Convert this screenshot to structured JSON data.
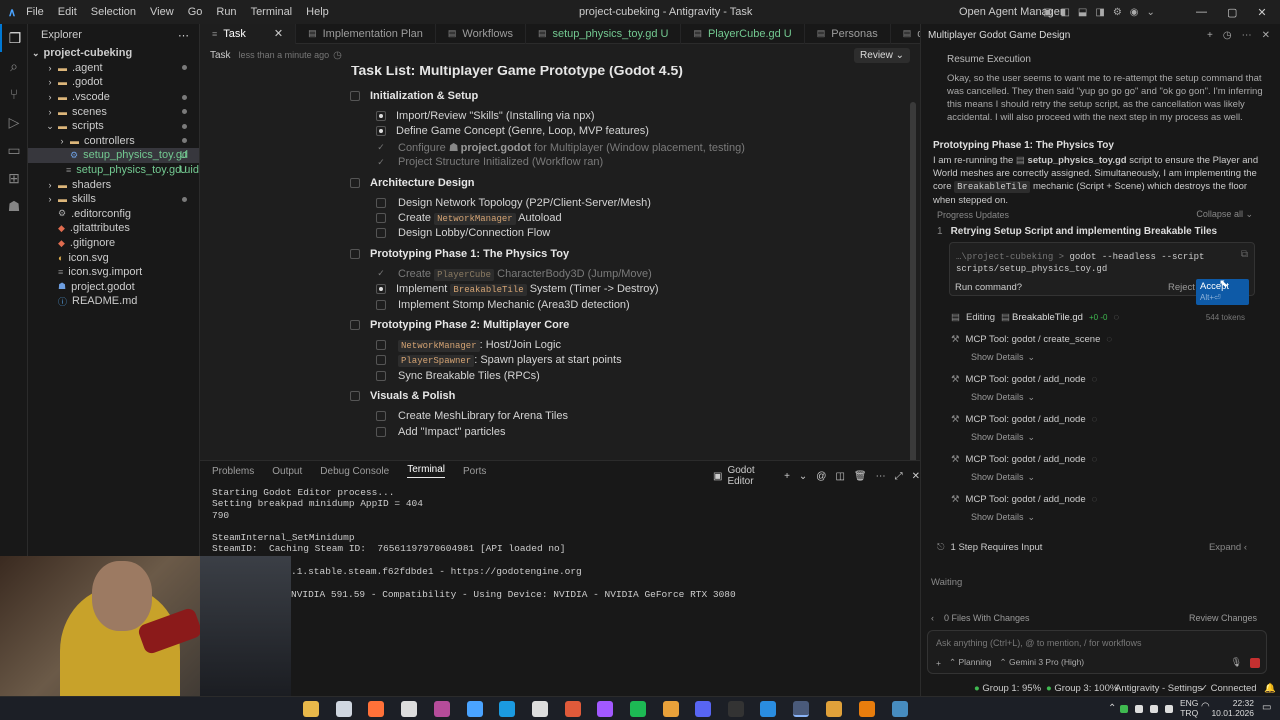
{
  "menu": [
    "File",
    "Edit",
    "Selection",
    "View",
    "Go",
    "Run",
    "Terminal",
    "Help"
  ],
  "window_title": "project-cubeking - Antigravity - Task",
  "open_agent_manager": "Open Agent Manager",
  "explorer": {
    "title": "Explorer",
    "root": "project-cubeking",
    "items": [
      {
        "label": ".agent",
        "indent": 1,
        "type": "folder",
        "dot": true
      },
      {
        "label": ".godot",
        "indent": 1,
        "type": "folder"
      },
      {
        "label": ".vscode",
        "indent": 1,
        "type": "folder",
        "dot": true
      },
      {
        "label": "scenes",
        "indent": 1,
        "type": "folder",
        "dot": true
      },
      {
        "label": "scripts",
        "indent": 1,
        "type": "folder-open",
        "dot": true
      },
      {
        "label": "controllers",
        "indent": 2,
        "type": "folder",
        "dot": true
      },
      {
        "label": "setup_physics_toy.gd",
        "indent": 2,
        "type": "gd",
        "badge": "U",
        "selected": true
      },
      {
        "label": "setup_physics_toy.gd.uid",
        "indent": 2,
        "type": "file",
        "badge": "U"
      },
      {
        "label": "shaders",
        "indent": 1,
        "type": "folder"
      },
      {
        "label": "skills",
        "indent": 1,
        "type": "folder",
        "dot": true
      },
      {
        "label": ".editorconfig",
        "indent": 1,
        "type": "cfg"
      },
      {
        "label": ".gitattributes",
        "indent": 1,
        "type": "git"
      },
      {
        "label": ".gitignore",
        "indent": 1,
        "type": "git"
      },
      {
        "label": "icon.svg",
        "indent": 1,
        "type": "svg"
      },
      {
        "label": "icon.svg.import",
        "indent": 1,
        "type": "file"
      },
      {
        "label": "project.godot",
        "indent": 1,
        "type": "godot"
      },
      {
        "label": "README.md",
        "indent": 1,
        "type": "md"
      }
    ]
  },
  "tabs": [
    {
      "label": "Task",
      "active": true
    },
    {
      "label": "Implementation Plan"
    },
    {
      "label": "Workflows"
    },
    {
      "label": "setup_physics_toy.gd U"
    },
    {
      "label": "PlayerCube.gd U"
    },
    {
      "label": "Personas"
    },
    {
      "label": "debug_"
    }
  ],
  "task_header": {
    "label": "Task",
    "time": "less than a minute ago",
    "review": "Review"
  },
  "task_title": "Task List: Multiplayer Game Prototype (Godot 4.5)",
  "sections": [
    {
      "title": "Initialization & Setup",
      "items": [
        {
          "state": "progress",
          "parts": [
            {
              "t": "Import/Review \"Skills\" (Installing via npx)"
            }
          ]
        },
        {
          "state": "progress",
          "parts": [
            {
              "t": "Define Game Concept (Genre, Loop, MVP features)"
            }
          ]
        },
        {
          "state": "done",
          "parts": [
            {
              "t": "Configure "
            },
            {
              "t": "project.godot",
              "bold": true
            },
            {
              "t": " for Multiplayer (Window placement, testing)"
            }
          ]
        },
        {
          "state": "done",
          "parts": [
            {
              "t": "Project Structure Initialized (Workflow ran)"
            }
          ]
        }
      ]
    },
    {
      "title": "Architecture Design",
      "items": [
        {
          "state": "todo",
          "parts": [
            {
              "t": "Design Network Topology (P2P/Client-Server/Mesh)"
            }
          ]
        },
        {
          "state": "todo",
          "parts": [
            {
              "t": "Create "
            },
            {
              "t": "NetworkManager",
              "code": true
            },
            {
              "t": " Autoload"
            }
          ]
        },
        {
          "state": "todo",
          "parts": [
            {
              "t": "Design Lobby/Connection Flow"
            }
          ]
        }
      ]
    },
    {
      "title": "Prototyping Phase 1: The Physics Toy",
      "items": [
        {
          "state": "done",
          "parts": [
            {
              "t": "Create "
            },
            {
              "t": "PlayerCube",
              "code": true
            },
            {
              "t": " CharacterBody3D (Jump/Move)"
            }
          ]
        },
        {
          "state": "progress",
          "parts": [
            {
              "t": "Implement "
            },
            {
              "t": "BreakableTile",
              "code": true
            },
            {
              "t": " System (Timer -> Destroy)"
            }
          ]
        },
        {
          "state": "todo",
          "parts": [
            {
              "t": "Implement Stomp Mechanic (Area3D detection)"
            }
          ]
        }
      ]
    },
    {
      "title": "Prototyping Phase 2: Multiplayer Core",
      "items": [
        {
          "state": "todo",
          "parts": [
            {
              "t": "NetworkManager",
              "code": true
            },
            {
              "t": ": Host/Join Logic"
            }
          ]
        },
        {
          "state": "todo",
          "parts": [
            {
              "t": "PlayerSpawner",
              "code": true
            },
            {
              "t": ": Spawn players at start points"
            }
          ]
        },
        {
          "state": "todo",
          "parts": [
            {
              "t": "Sync Breakable Tiles (RPCs)"
            }
          ]
        }
      ]
    },
    {
      "title": "Visuals & Polish",
      "items": [
        {
          "state": "todo",
          "parts": [
            {
              "t": "Create MeshLibrary for Arena Tiles"
            }
          ]
        },
        {
          "state": "todo",
          "parts": [
            {
              "t": "Add \"Impact\" particles"
            }
          ]
        }
      ]
    }
  ],
  "terminal": {
    "tabs": [
      "Problems",
      "Output",
      "Debug Console",
      "Terminal",
      "Ports"
    ],
    "active": "Terminal",
    "profile": "Godot Editor",
    "lines": [
      "Starting Godot Editor process...",
      "Setting breakpad minidump AppID = 404",
      "790",
      "",
      "SteamInternal_SetMinidump",
      "SteamID:  Caching Steam ID:  76561197970604981 [API loaded no]",
      "",
      ".1.stable.steam.f62fdbde1 - https://godotengine.org",
      "",
      "NVIDIA 591.59 - Compatibility - Using Device: NVIDIA - NVIDIA GeForce RTX 3080"
    ]
  },
  "agent": {
    "title": "Multiplayer Godot Game Design",
    "resume": "Resume Execution",
    "thought": "Okay, so the user seems to want me to re-attempt the setup command that was cancelled. They then said \"yup go go go\" and \"ok go gon\". I'm inferring this means I should retry the setup script, as the cancellation was likely accidental. I will also proceed with the next step in my process as well.",
    "phase_title": "Prototyping Phase 1: The Physics Toy",
    "phase_pre": "I am re-running the ",
    "phase_file": "setup_physics_toy.gd",
    "phase_mid": " script to ensure the Player and World meshes are correctly assigned. Simultaneously, I am implementing the core ",
    "phase_code": "BreakableTile",
    "phase_post": " mechanic (Script + Scene) which destroys the floor when stepped on.",
    "progress_label": "Progress Updates",
    "collapse": "Collapse all",
    "step_title": "Retrying Setup Script and implementing Breakable Tiles",
    "cmd_path": "…\\project-cubeking",
    "cmd": "godot --headless --script scripts/setup_physics_toy.gd",
    "run_q": "Run command?",
    "reject": "Reject",
    "accept": "Accept",
    "accept_hint": "Alt+⏎",
    "editing": "Editing",
    "editing_file": "BreakableTile.gd",
    "editing_delta": "+0 -0",
    "tokens": "544 tokens",
    "tools": [
      "MCP Tool: godot / create_scene",
      "MCP Tool: godot / add_node",
      "MCP Tool: godot / add_node",
      "MCP Tool: godot / add_node",
      "MCP Tool: godot / add_node"
    ],
    "show_details": "Show Details",
    "requires_input": "1 Step Requires Input",
    "expand": "Expand",
    "waiting": "Waiting",
    "files_changed": "0 Files With Changes",
    "review_changes": "Review Changes",
    "input_placeholder": "Ask anything (Ctrl+L), @ to mention, / for workflows",
    "mode": "Planning",
    "model": "Gemini 3 Pro (High)"
  },
  "status": {
    "group1": "Group 1: 95%",
    "group3": "Group 3: 100%",
    "settings": "Antigravity - Settings",
    "connected": "Connected"
  },
  "taskbar": {
    "lang1": "ENG",
    "lang2": "TRQ",
    "time": "22:32",
    "date": "10.01.2026"
  },
  "colors": {
    "accent": "#0078d4",
    "folder": "#dcb67a",
    "untracked": "#73c991",
    "green": "#3fb950"
  }
}
